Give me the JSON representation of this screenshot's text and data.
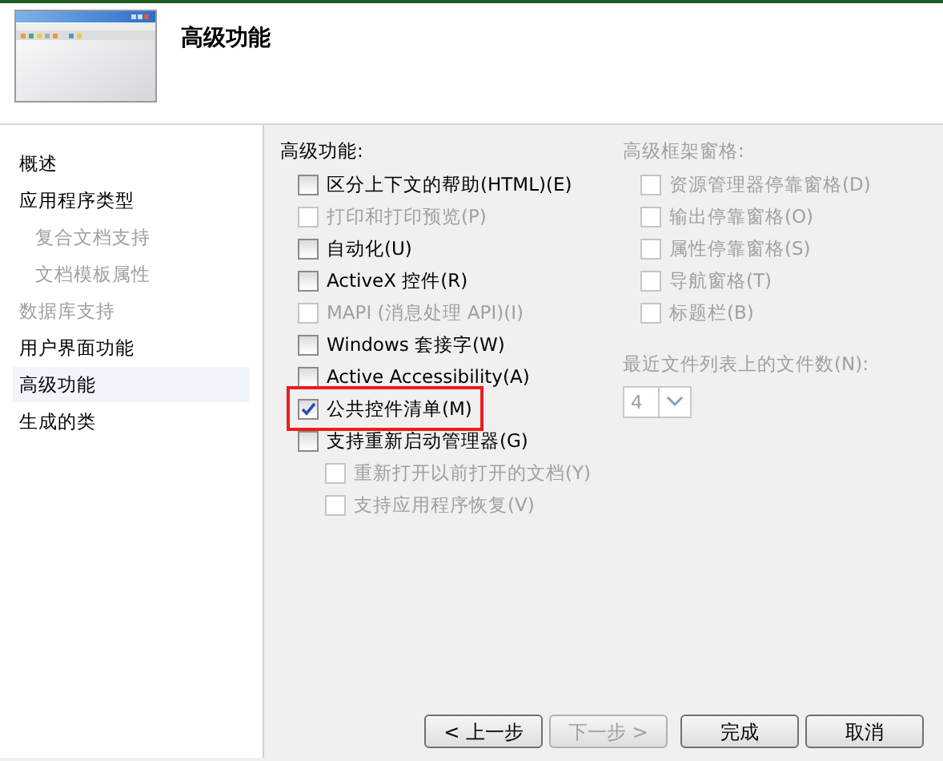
{
  "header": {
    "title": "高级功能"
  },
  "sidebar": {
    "items": [
      {
        "label": "概述",
        "disabled": false,
        "selected": false
      },
      {
        "label": "应用程序类型",
        "disabled": false,
        "selected": false,
        "children": [
          {
            "label": "复合文档支持",
            "disabled": true,
            "selected": false
          },
          {
            "label": "文档模板属性",
            "disabled": true,
            "selected": false
          }
        ]
      },
      {
        "label": "数据库支持",
        "disabled": true,
        "selected": false
      },
      {
        "label": "用户界面功能",
        "disabled": false,
        "selected": false
      },
      {
        "label": "高级功能",
        "disabled": false,
        "selected": true
      },
      {
        "label": "生成的类",
        "disabled": false,
        "selected": false
      }
    ]
  },
  "advanced_features": {
    "label": "高级功能:",
    "disabled": false,
    "options": [
      {
        "label": "区分上下文的帮助(HTML)(E)",
        "checked": false,
        "disabled": false,
        "highlighted": false
      },
      {
        "label": "打印和打印预览(P)",
        "checked": false,
        "disabled": true,
        "highlighted": false
      },
      {
        "label": "自动化(U)",
        "checked": false,
        "disabled": false,
        "highlighted": false
      },
      {
        "label": "ActiveX 控件(R)",
        "checked": false,
        "disabled": false,
        "highlighted": false
      },
      {
        "label": "MAPI (消息处理 API)(I)",
        "checked": false,
        "disabled": true,
        "highlighted": false
      },
      {
        "label": "Windows 套接字(W)",
        "checked": false,
        "disabled": false,
        "highlighted": false
      },
      {
        "label": "Active Accessibility(A)",
        "checked": false,
        "disabled": false,
        "highlighted": false
      },
      {
        "label": "公共控件清单(M)",
        "checked": true,
        "disabled": false,
        "highlighted": true
      },
      {
        "label": "支持重新启动管理器(G)",
        "checked": false,
        "disabled": false,
        "highlighted": false,
        "children": [
          {
            "label": "重新打开以前打开的文档(Y)",
            "checked": false,
            "disabled": true,
            "highlighted": false
          },
          {
            "label": "支持应用程序恢复(V)",
            "checked": false,
            "disabled": true,
            "highlighted": false
          }
        ]
      }
    ]
  },
  "frame_panes": {
    "label": "高级框架窗格:",
    "disabled": true,
    "options": [
      {
        "label": "资源管理器停靠窗格(D)",
        "checked": false,
        "disabled": true,
        "highlighted": false
      },
      {
        "label": "输出停靠窗格(O)",
        "checked": false,
        "disabled": true,
        "highlighted": false
      },
      {
        "label": "属性停靠窗格(S)",
        "checked": false,
        "disabled": true,
        "highlighted": false
      },
      {
        "label": "导航窗格(T)",
        "checked": false,
        "disabled": true,
        "highlighted": false
      },
      {
        "label": "标题栏(B)",
        "checked": false,
        "disabled": true,
        "highlighted": false
      }
    ]
  },
  "recent_files": {
    "label": "最近文件列表上的文件数(N):",
    "value": "4",
    "disabled": true
  },
  "buttons": [
    {
      "label": "< 上一步",
      "disabled": false
    },
    {
      "label": "下一步 >",
      "disabled": true
    },
    {
      "label": "完成",
      "disabled": false
    },
    {
      "label": "取消",
      "disabled": false
    }
  ]
}
